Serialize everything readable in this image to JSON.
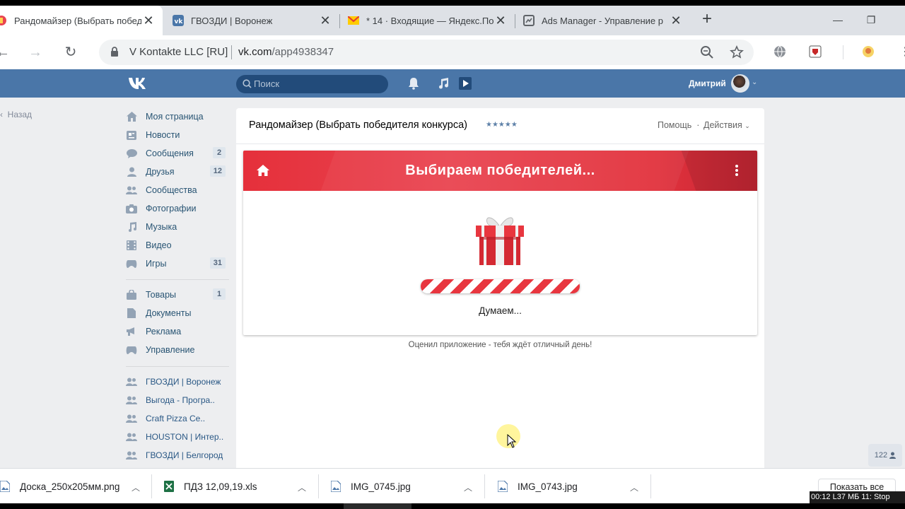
{
  "browser": {
    "tabs": [
      {
        "title": "Рандомайзер (Выбрать побед",
        "active": true
      },
      {
        "title": "ГВОЗДИ | Воронеж",
        "active": false
      },
      {
        "title": "* 14 · Входящие — Яндекс.По",
        "active": false
      },
      {
        "title": "Ads Manager - Управление р",
        "active": false
      }
    ],
    "site_identity": "V Kontakte LLC [RU]",
    "url_host": "vk.com",
    "url_path": "/app4938347"
  },
  "vk": {
    "search_placeholder": "Поиск",
    "user_name": "Дмитрий",
    "back_label": "Назад",
    "menu": [
      {
        "label": "Моя страница",
        "count": null,
        "icon": "home-icon"
      },
      {
        "label": "Новости",
        "count": null,
        "icon": "news-icon"
      },
      {
        "label": "Сообщения",
        "count": "2",
        "icon": "messages-icon"
      },
      {
        "label": "Друзья",
        "count": "12",
        "icon": "friends-icon"
      },
      {
        "label": "Сообщества",
        "count": null,
        "icon": "groups-icon"
      },
      {
        "label": "Фотографии",
        "count": null,
        "icon": "camera-icon"
      },
      {
        "label": "Музыка",
        "count": null,
        "icon": "music-icon"
      },
      {
        "label": "Видео",
        "count": null,
        "icon": "video-icon"
      },
      {
        "label": "Игры",
        "count": "31",
        "icon": "games-icon"
      },
      {
        "label": "Товары",
        "count": "1",
        "icon": "bag-icon"
      },
      {
        "label": "Документы",
        "count": null,
        "icon": "document-icon"
      },
      {
        "label": "Реклама",
        "count": null,
        "icon": "megaphone-icon"
      },
      {
        "label": "Управление",
        "count": null,
        "icon": "gamepad-icon"
      }
    ],
    "communities": [
      "ГВОЗДИ | Воронеж",
      "Выгода - Програ..",
      "Craft Pizza Ce..",
      "HOUSTON | Интер..",
      "ГВОЗДИ | Белгород"
    ],
    "online_count": "122"
  },
  "app": {
    "title": "Рандомайзер (Выбрать победителя конкурса)",
    "rating": "★★★★★",
    "help_label": "Помощь",
    "actions_label": "Действия",
    "header_title": "Выбираем победителей...",
    "progress_percent": 100,
    "status_text": "Думаем...",
    "footer_text": "Оценил приложение - тебя ждёт отличный день!"
  },
  "downloads": {
    "items": [
      {
        "name": "Доска_250х205мм.png",
        "type": "image"
      },
      {
        "name": "ПДЗ 12,09,19.xls",
        "type": "excel"
      },
      {
        "name": "IMG_0745.jpg",
        "type": "image"
      },
      {
        "name": "IMG_0743.jpg",
        "type": "image"
      }
    ],
    "show_all_label": "Показать все"
  },
  "recorder": {
    "text": "00:12 L37 МБ 11: Stop"
  },
  "colors": {
    "vk_blue": "#4a76a8",
    "app_red": "#e5303b",
    "link": "#285473"
  }
}
